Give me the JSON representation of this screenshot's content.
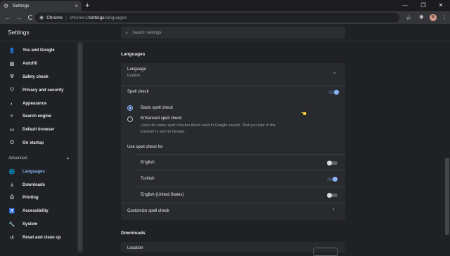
{
  "tab": {
    "title": "Settings",
    "icon": "gear-icon",
    "close": "×",
    "new_tab": "+"
  },
  "window_controls": {
    "minimize": "—",
    "maximize": "❐",
    "close": "✕"
  },
  "toolbar": {
    "back": "←",
    "forward": "→",
    "reload": "C",
    "chip": "Chrome",
    "url_scheme": "chrome://",
    "url_host": "settings",
    "url_path": "/languages",
    "profile_initial": "B"
  },
  "settings": {
    "title": "Settings",
    "search_placeholder": "Search settings"
  },
  "sidebar": {
    "items": [
      {
        "label": "You and Google",
        "icon": "person-icon"
      },
      {
        "label": "Autofill",
        "icon": "clipboard-icon"
      },
      {
        "label": "Safety check",
        "icon": "shield-check-icon"
      },
      {
        "label": "Privacy and security",
        "icon": "shield-icon"
      },
      {
        "label": "Appearance",
        "icon": "palette-icon"
      },
      {
        "label": "Search engine",
        "icon": "search-icon"
      },
      {
        "label": "Default browser",
        "icon": "browser-icon"
      },
      {
        "label": "On startup",
        "icon": "power-icon"
      }
    ],
    "advanced": "Advanced",
    "advanced_items": [
      {
        "label": "Languages",
        "icon": "globe-icon",
        "active": true
      },
      {
        "label": "Downloads",
        "icon": "download-icon"
      },
      {
        "label": "Printing",
        "icon": "printer-icon"
      },
      {
        "label": "Accessibility",
        "icon": "accessibility-icon"
      },
      {
        "label": "System",
        "icon": "wrench-icon"
      },
      {
        "label": "Reset and clean up",
        "icon": "history-icon"
      }
    ]
  },
  "languages": {
    "section_title": "Languages",
    "language_label": "Language",
    "language_value": "English",
    "spell_check_label": "Spell check",
    "spell_check_on": true,
    "basic_label": "Basic spell check",
    "enhanced_label": "Enhanced spell check",
    "enhanced_desc_1": "Uses the same spell checker that's used in Google search. Text you type in the",
    "enhanced_desc_2": "browser is sent to Google.",
    "use_for_label": "Use spell check for",
    "spell_languages": [
      {
        "name": "English",
        "on": false
      },
      {
        "name": "Turkish",
        "on": true
      },
      {
        "name": "English (United States)",
        "on": false
      }
    ],
    "customize_label": "Customize spell check"
  },
  "downloads": {
    "section_title": "Downloads",
    "location_label": "Location"
  },
  "colors": {
    "accent": "#8ab4f8",
    "background": "#202124",
    "card": "#292a2d"
  }
}
